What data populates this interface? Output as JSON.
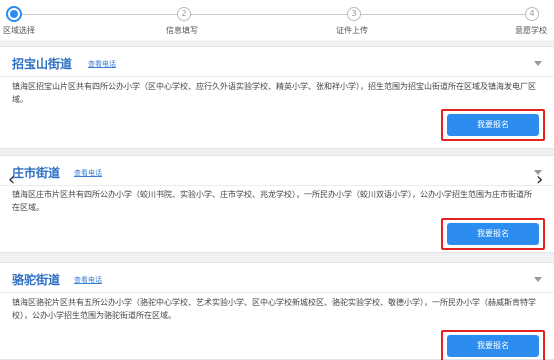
{
  "steps": [
    {
      "label": "区域选择",
      "number": "1"
    },
    {
      "label": "信息填写",
      "number": "2"
    },
    {
      "label": "证件上传",
      "number": "3"
    },
    {
      "label": "意愿学校",
      "number": "4"
    }
  ],
  "cards": [
    {
      "title": "招宝山街道",
      "phone_link": "查看电话",
      "description": "镇海区招宝山片区共有四所公办小学（区中心学校、应行久外语实验学校、精英小学、张和祥小学），招生范围为招宝山街道所在区域及镇海发电厂区域。",
      "apply_label": "我要报名"
    },
    {
      "title": "庄市街道",
      "phone_link": "查看电话",
      "description": "镇海区庄市片区共有四所公办小学（蛟川书院、实验小学、庄市学校、兆龙学校），一所民办小学（蛟川双语小学），公办小学招生范围为庄市街道所在区域。",
      "apply_label": "我要报名"
    },
    {
      "title": "骆驼街道",
      "phone_link": "查看电话",
      "description": "镇海区骆驼片区共有五所公办小学（骆驼中心学校、艺术实验小学、区中心学校新城校区、骆驼实验学校、敬德小学），一所民办小学（赫威斯肯特学校），公办小学招生范围为骆驼街道所在区域。",
      "apply_label": "我要报名"
    }
  ],
  "carousel": {
    "prev": "‹",
    "next": "›"
  },
  "colors": {
    "accent": "#2d8cf0",
    "title": "#2d6fc4",
    "highlight": "#e52222"
  }
}
